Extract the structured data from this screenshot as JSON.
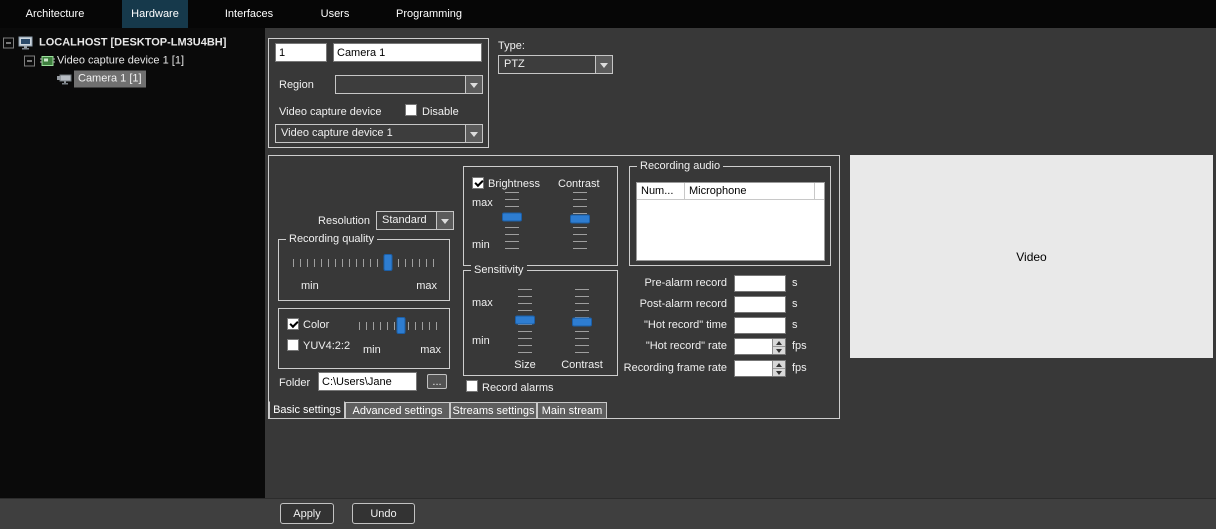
{
  "topbar": {
    "tabs": [
      {
        "label": "Architecture"
      },
      {
        "label": "Hardware"
      },
      {
        "label": "Interfaces"
      },
      {
        "label": "Users"
      },
      {
        "label": "Programming"
      }
    ]
  },
  "tree": {
    "items": [
      {
        "label": "LOCALHOST [DESKTOP-LM3U4BH]"
      },
      {
        "label": "Video capture device 1 [1]"
      },
      {
        "label": "Camera 1 [1]"
      }
    ]
  },
  "identity": {
    "id_value": "1",
    "name_value": "Camera 1",
    "region_label": "Region",
    "region_value": "",
    "parent_label": "Video capture device",
    "disable_label": "Disable",
    "parent_value": "Video capture device 1",
    "type_label": "Type:",
    "type_value": "PTZ"
  },
  "settings": {
    "resolution_label": "Resolution",
    "resolution_value": "Standard",
    "recording_quality": {
      "title": "Recording quality",
      "min_label": "min",
      "max_label": "max",
      "value_pct": 66
    },
    "color": {
      "color_label": "Color",
      "yuv_label": "YUV4:2:2",
      "min_label": "min",
      "max_label": "max",
      "value_pct": 50
    },
    "folder": {
      "label": "Folder",
      "value": "C:\\Users\\Jane",
      "browse_label": "..."
    },
    "brightness_group": {
      "brightness_label": "Brightness",
      "contrast_label": "Contrast",
      "max_label": "max",
      "min_label": "min",
      "brightness_pct": 42,
      "contrast_pct": 45
    },
    "sensitivity": {
      "title": "Sensitivity",
      "max_label": "max",
      "min_label": "min",
      "size_label": "Size",
      "contrast_label": "Contrast",
      "size_pct": 48,
      "contrast_pct": 52
    },
    "record_alarms_label": "Record alarms",
    "recording_audio": {
      "title": "Recording audio",
      "columns": [
        "Num...",
        "Microphone"
      ]
    },
    "timings": [
      {
        "label": "Pre-alarm record",
        "value": "",
        "unit": "s"
      },
      {
        "label": "Post-alarm record",
        "value": "",
        "unit": "s"
      },
      {
        "label": "\"Hot record\" time",
        "value": "",
        "unit": "s"
      },
      {
        "label": "\"Hot record\" rate",
        "value": "",
        "unit": "fps"
      },
      {
        "label": "Recording frame rate",
        "value": "",
        "unit": "fps"
      }
    ],
    "tabs": [
      {
        "label": "Basic settings"
      },
      {
        "label": "Advanced settings"
      },
      {
        "label": "Streams settings"
      },
      {
        "label": "Main stream"
      }
    ]
  },
  "video_panel": {
    "label": "Video"
  },
  "footer": {
    "apply_label": "Apply",
    "undo_label": "Undo"
  }
}
